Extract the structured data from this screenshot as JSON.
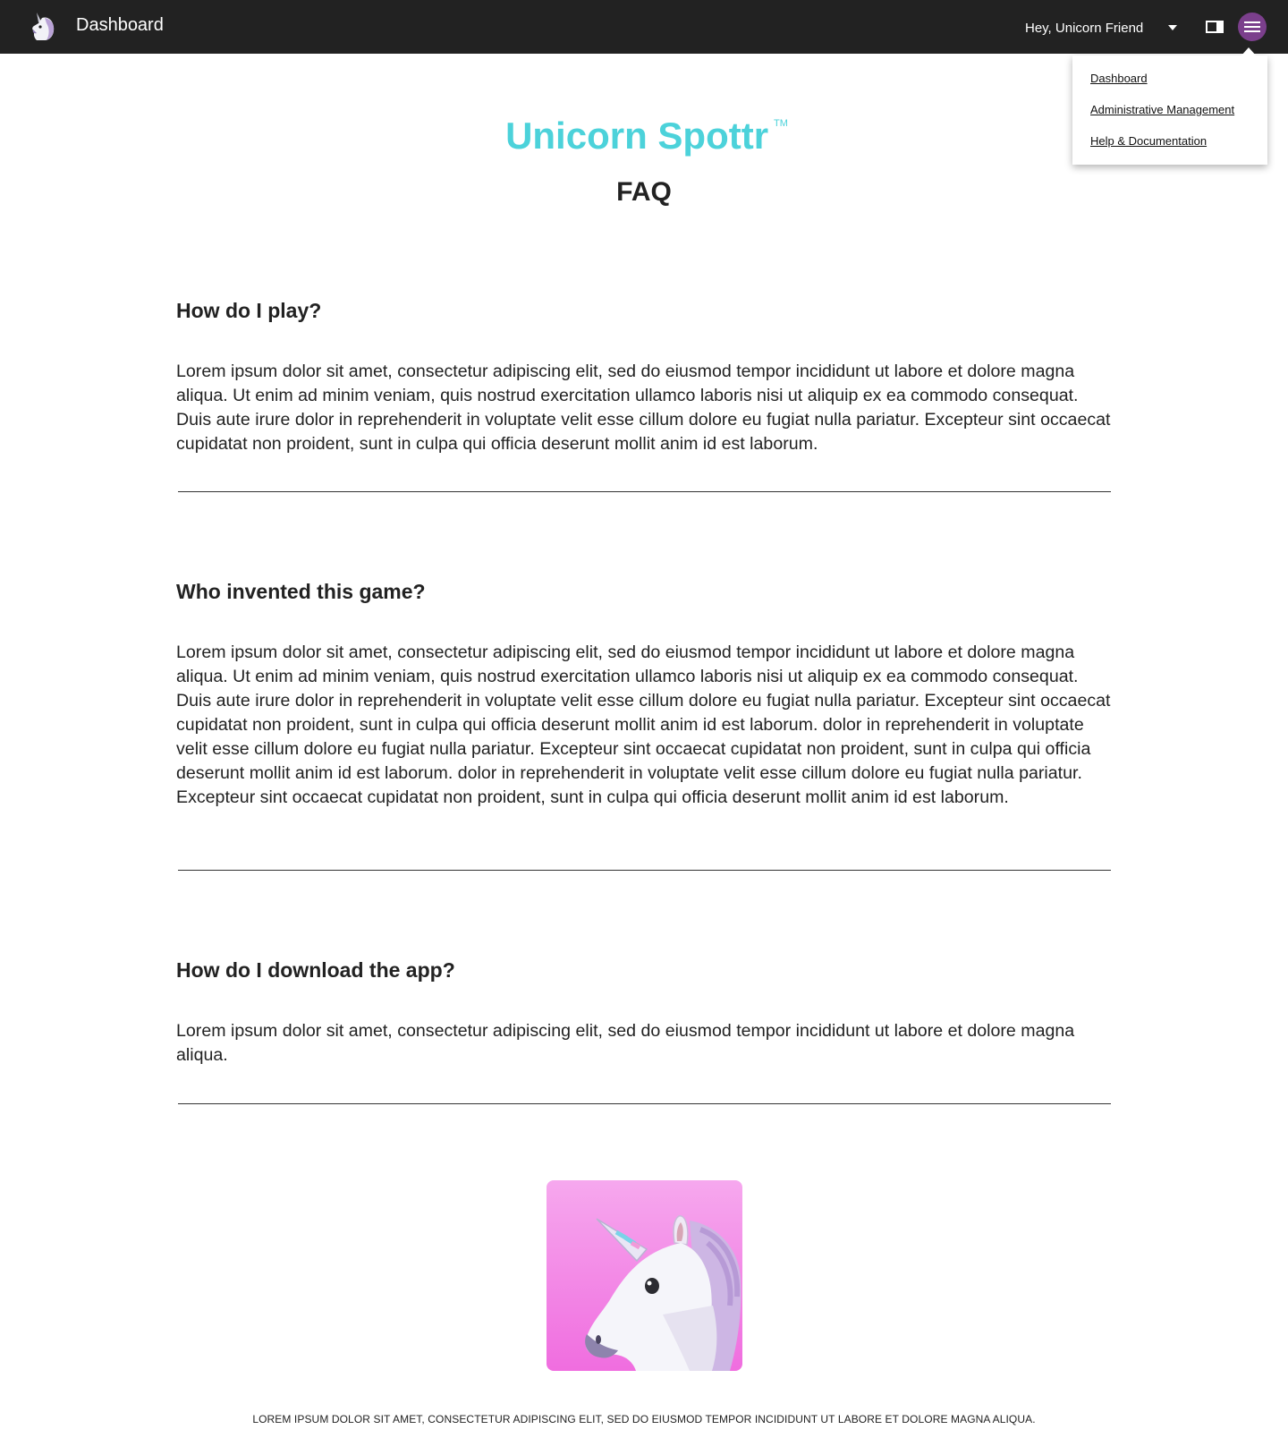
{
  "topbar": {
    "title": "Dashboard",
    "greeting": "Hey, Unicorn Friend",
    "logo_icon": "unicorn-icon",
    "window_icon": "window-toggle-icon",
    "menu_icon": "hamburger-menu-icon",
    "menu_button_color": "#7b3f8c",
    "background": "#222222"
  },
  "dropdown": {
    "items": [
      {
        "label": "Dashboard"
      },
      {
        "label": "Administrative Management"
      },
      {
        "label": "Help & Documentation"
      }
    ]
  },
  "header": {
    "brand": "Unicorn Spottr",
    "trademark": "TM",
    "brand_color": "#4cd2da",
    "page_title": "FAQ"
  },
  "faq": [
    {
      "question": "How do I play?",
      "answer": "Lorem ipsum dolor sit amet, consectetur adipiscing elit, sed do eiusmod tempor incididunt ut labore et dolore magna aliqua. Ut enim ad minim veniam, quis nostrud exercitation ullamco laboris nisi ut aliquip ex ea commodo consequat. Duis aute irure dolor in reprehenderit in voluptate velit esse cillum dolore eu fugiat nulla pariatur. Excepteur sint occaecat cupidatat non proident, sunt in culpa qui officia deserunt mollit anim id est laborum."
    },
    {
      "question": "Who invented this game?",
      "answer": "Lorem ipsum dolor sit amet, consectetur adipiscing elit, sed do eiusmod tempor incididunt ut labore et dolore magna aliqua. Ut enim ad minim veniam, quis nostrud exercitation ullamco laboris nisi ut aliquip ex ea commodo consequat. Duis aute irure dolor in reprehenderit in voluptate velit esse cillum dolore eu fugiat nulla pariatur. Excepteur sint occaecat cupidatat non proident, sunt in culpa qui officia deserunt mollit anim id est laborum. dolor in reprehenderit in voluptate velit esse cillum dolore eu fugiat nulla pariatur. Excepteur sint occaecat cupidatat non proident, sunt in culpa qui officia deserunt mollit anim id est laborum. dolor in reprehenderit in voluptate velit esse cillum dolore eu fugiat nulla pariatur. Excepteur sint occaecat cupidatat non proident, sunt in culpa qui officia deserunt mollit anim id est laborum."
    },
    {
      "question": "How do I download the app?",
      "answer": "Lorem ipsum dolor sit amet, consectetur adipiscing elit, sed do eiusmod tempor incididunt ut labore et dolore magna aliqua."
    }
  ],
  "app_icon": {
    "icon": "unicorn-app-icon"
  },
  "footer": {
    "text": "LOREM IPSUM DOLOR SIT AMET, CONSECTETUR ADIPISCING ELIT, SED DO EIUSMOD TEMPOR INCIDIDUNT UT LABORE ET DOLORE MAGNA ALIQUA."
  }
}
